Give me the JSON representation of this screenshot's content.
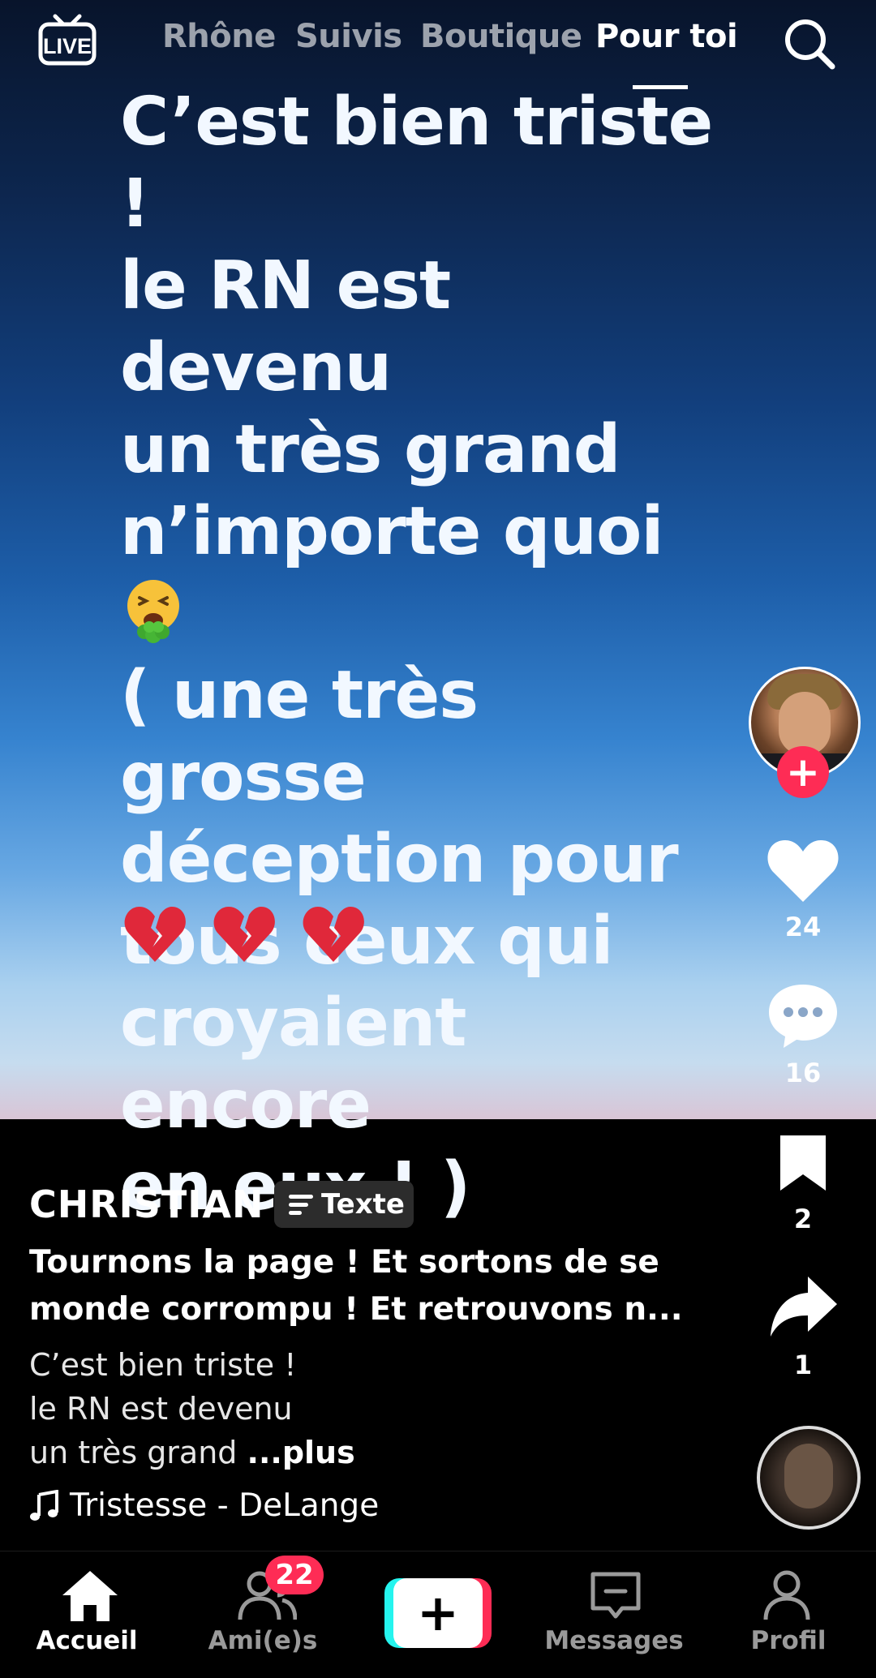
{
  "top_nav": {
    "live_label": "LIVE",
    "tabs": [
      "Rhône",
      "Suivis",
      "Boutique",
      "Pour toi"
    ],
    "active_tab": "Pour toi"
  },
  "post": {
    "text": "C’est bien triste !\nle RN est  devenu\nun très grand\nn’importe quoi  ",
    "text2": "\n( une très grosse\ndéception pour\ntous ceux qui\ncroyaient encore\nen eux ! )",
    "emojis": [
      "nauseated-face",
      "broken-heart",
      "broken-heart",
      "broken-heart"
    ]
  },
  "actions": {
    "likes": "24",
    "comments": "16",
    "saves": "2",
    "shares": "1"
  },
  "caption": {
    "author": "CHRISTIAN",
    "badge": "Texte",
    "title": "Tournons la page ! Et sortons de se\nmonde corrompu ! Et retrouvons n...",
    "description": "C’est bien triste !\nle RN est  devenu\nun très grand ",
    "more": "...plus",
    "music": "Tristesse - DeLange"
  },
  "bottom_nav": {
    "home": "Accueil",
    "friends": "Ami(e)s",
    "friends_badge": "22",
    "create": "+",
    "messages": "Messages",
    "profile": "Profil"
  },
  "colors": {
    "accent_red": "#fe2c55",
    "accent_cyan": "#25f4ee"
  }
}
